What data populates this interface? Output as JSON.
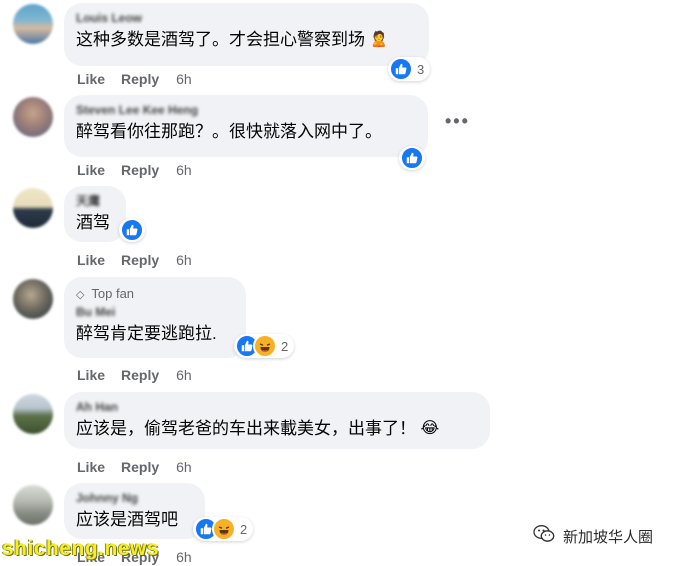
{
  "comments": [
    {
      "name": "Louis Leow",
      "text": "这种多数是酒驾了。才会担心警察到场",
      "reaction_count": "3",
      "like_label": "Like",
      "reply_label": "Reply",
      "time": "6h"
    },
    {
      "name": "Steven Lee Kee Heng",
      "text": "醉驾看你往那跑？。很快就落入网中了。",
      "like_label": "Like",
      "reply_label": "Reply",
      "time": "6h"
    },
    {
      "name": "天鹰",
      "text": "酒驾",
      "like_label": "Like",
      "reply_label": "Reply",
      "time": "6h"
    },
    {
      "badge": "Top fan",
      "name": "Bu Mei",
      "text": "醉驾肯定要逃跑拉.",
      "reaction_count": "2",
      "like_label": "Like",
      "reply_label": "Reply",
      "time": "6h"
    },
    {
      "name": "Ah Han",
      "text": "应该是，偷驾老爸的车出来載美女，出事了！",
      "like_label": "Like",
      "reply_label": "Reply",
      "time": "6h"
    },
    {
      "name": "Johnny Ng",
      "text": "应该是酒驾吧",
      "reaction_count": "2",
      "like_label": "Like",
      "reply_label": "Reply",
      "time": "6h"
    }
  ],
  "more_label": "•••",
  "watermark": {
    "left": "shicheng.news",
    "right": "新加坡华人圈"
  },
  "colors": {
    "bubble": "#f0f2f5",
    "like_blue": "#1877f2",
    "haha_yellow": "#f7b125",
    "meta_gray": "#65676b"
  }
}
